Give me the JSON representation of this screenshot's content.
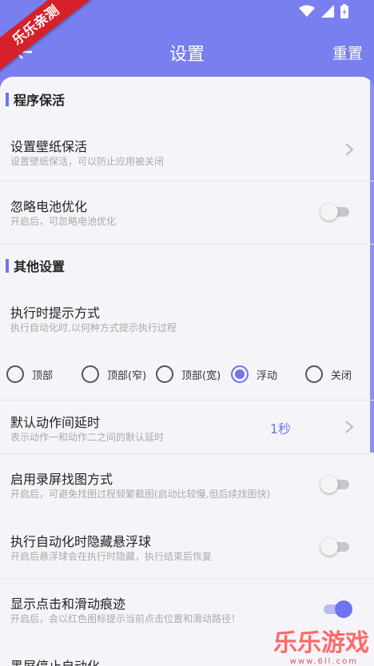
{
  "ribbon": "乐乐亲测",
  "header": {
    "title": "设置",
    "reset": "重置"
  },
  "sections": [
    {
      "label": "程序保活"
    },
    {
      "label": "其他设置"
    }
  ],
  "rows": {
    "wallpaper": {
      "title": "设置壁纸保活",
      "subtitle": "设置壁纸保活，可以防止应用被关闭"
    },
    "battery": {
      "title": "忽略电池优化",
      "subtitle": "开启后，可忽略电池优化",
      "enabled": false
    },
    "prompt": {
      "title": "执行时提示方式",
      "subtitle": "执行自动化时,以何种方式提示执行过程"
    },
    "delay": {
      "title": "默认动作间延时",
      "subtitle": "表示动作一和动作二之间的默认延时",
      "value": "1秒"
    },
    "screen_record": {
      "title": "启用录屏找图方式",
      "subtitle": "开启后，可避免找图过程频繁截图(启动比较慢,但后续找图快)",
      "enabled": false
    },
    "hide_float": {
      "title": "执行自动化时隐藏悬浮球",
      "subtitle": "开启后悬浮球会在执行时隐藏，执行结束后恢复",
      "enabled": false
    },
    "show_trace": {
      "title": "显示点击和滑动痕迹",
      "subtitle": "开启后，会以红色图标提示当前点击位置和滑动路径！",
      "enabled": true
    },
    "screen_off": {
      "title": "黑屏停止自动化"
    }
  },
  "prompt_options": [
    {
      "label": "顶部",
      "selected": false
    },
    {
      "label": "顶部(窄)",
      "selected": false
    },
    {
      "label": "顶部(宽)",
      "selected": false
    },
    {
      "label": "浮动",
      "selected": true
    },
    {
      "label": "关闭",
      "selected": false
    }
  ],
  "watermark": {
    "text": "乐乐游戏",
    "url": "www.6ll.com"
  },
  "colors": {
    "accent": "#6f74ef",
    "header": "#7a7ff0",
    "ribbon": "#d6202a"
  }
}
